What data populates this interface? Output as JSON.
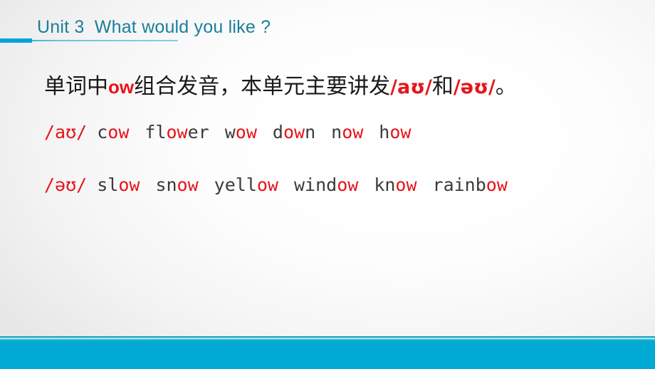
{
  "slide": {
    "title": "Unit 3  What would you like ?",
    "colors": {
      "title_text": "#1b7e9b",
      "accent_bar": "#00a3dd",
      "footer_band": "#00aad4",
      "highlight_red": "#e8131a",
      "body_text": "#3b3b3b"
    }
  },
  "intro": {
    "part1": "单词中",
    "highlight1": "ow",
    "part2": "组合发音，本单元主要讲发",
    "phonetic1": "/aʊ/",
    "part3": "和",
    "phonetic2": "/əʊ/",
    "part4": "。"
  },
  "rows": [
    {
      "phonetic": "/aʊ/",
      "words": [
        {
          "pre": "c",
          "ow": "ow",
          "post": ""
        },
        {
          "pre": "fl",
          "ow": "ow",
          "post": "er"
        },
        {
          "pre": "w",
          "ow": "ow",
          "post": ""
        },
        {
          "pre": "d",
          "ow": "ow",
          "post": "n"
        },
        {
          "pre": "n",
          "ow": "ow",
          "post": ""
        },
        {
          "pre": "h",
          "ow": "ow",
          "post": ""
        }
      ]
    },
    {
      "phonetic": "/əʊ/",
      "words": [
        {
          "pre": "sl",
          "ow": "ow",
          "post": ""
        },
        {
          "pre": "sn",
          "ow": "ow",
          "post": ""
        },
        {
          "pre": "yell",
          "ow": "ow",
          "post": ""
        },
        {
          "pre": "wind",
          "ow": "ow",
          "post": ""
        },
        {
          "pre": "kn",
          "ow": "ow",
          "post": ""
        },
        {
          "pre": "rainb",
          "ow": "ow",
          "post": ""
        }
      ]
    }
  ]
}
